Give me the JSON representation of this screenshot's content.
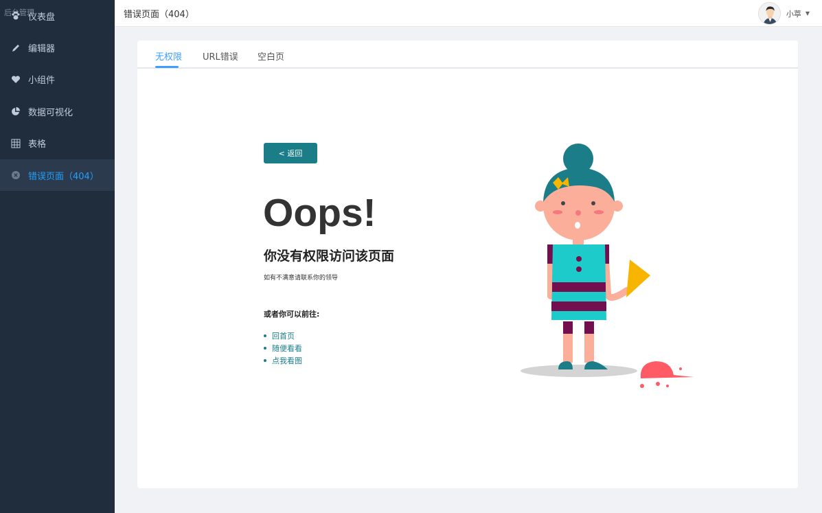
{
  "sidebar": {
    "brand": "后台管理",
    "items": [
      {
        "label": "仪表盘",
        "icon": "paw-icon"
      },
      {
        "label": "编辑器",
        "icon": "pencil-icon"
      },
      {
        "label": "小组件",
        "icon": "heart-icon"
      },
      {
        "label": "数据可视化",
        "icon": "pie-chart-icon"
      },
      {
        "label": "表格",
        "icon": "grid-icon"
      },
      {
        "label": "错误页面（404）",
        "icon": "close-circle-icon"
      }
    ],
    "active_index": 5
  },
  "header": {
    "title": "错误页面（404）",
    "user_name": "小葶"
  },
  "tabs": [
    "无权限",
    "URL错误",
    "空白页"
  ],
  "content": {
    "back_button": "< 返回",
    "oops": "Oops!",
    "subhead": "你没有权限访问该页面",
    "note": "如有不满意请联系你的领导",
    "go_label": "或者你可以前往:",
    "links": [
      "回首页",
      "随便看看",
      "点我看图"
    ]
  },
  "colors": {
    "sidebar_bg": "#1f2d3d",
    "accent": "#409eff",
    "button": "#1a7d88"
  }
}
